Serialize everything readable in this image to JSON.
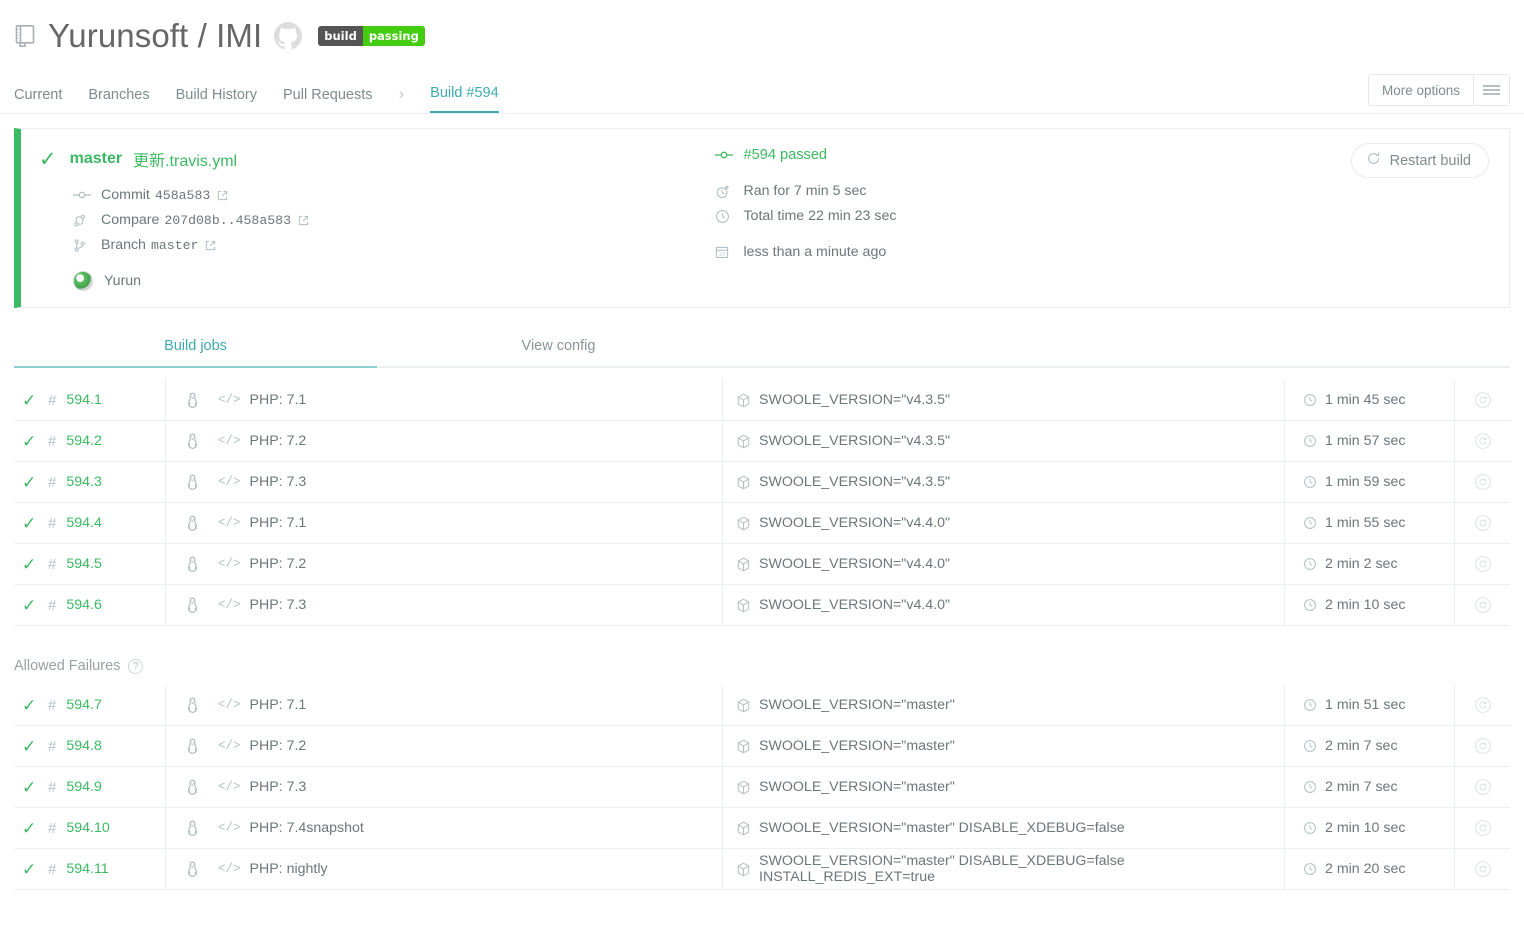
{
  "header": {
    "repo_icon": "repository-icon",
    "title": "Yurunsoft / IMI",
    "github_icon": "github-octocat-icon",
    "badge": {
      "left": "build",
      "right": "passing",
      "left_color": "#555555",
      "right_color": "#44cc11"
    }
  },
  "nav": {
    "tabs": [
      {
        "label": "Current",
        "active": false
      },
      {
        "label": "Branches",
        "active": false
      },
      {
        "label": "Build History",
        "active": false
      },
      {
        "label": "Pull Requests",
        "active": false
      }
    ],
    "separator": "›",
    "breadcrumb_current": "Build #594",
    "more_options_label": "More options"
  },
  "summary": {
    "state_icon": "check-icon",
    "branch": "master",
    "commit_message": "更新.travis.yml",
    "meta": [
      {
        "icon": "commit-icon",
        "label": "Commit",
        "value": "458a583",
        "mono": true,
        "external": true
      },
      {
        "icon": "compare-icon",
        "label": "Compare",
        "value": "207d08b..458a583",
        "mono": true,
        "external": true
      },
      {
        "icon": "branch-icon",
        "label": "Branch",
        "value": "master",
        "mono": true,
        "external": true
      }
    ],
    "author": "Yurun",
    "status": "#594 passed",
    "status_icon": "commit-icon",
    "timings": [
      {
        "icon": "stopwatch-icon",
        "text": "Ran for 7 min 5 sec"
      },
      {
        "icon": "clock-icon",
        "text": "Total time 22 min 23 sec"
      }
    ],
    "finished": {
      "icon": "calendar-icon",
      "text": "less than a minute ago"
    },
    "restart_label": "Restart build",
    "accent_color": "#3cb963"
  },
  "jobs_tabs": [
    {
      "label": "Build jobs",
      "active": true
    },
    {
      "label": "View config",
      "active": false
    }
  ],
  "jobs": [
    {
      "state": "✓",
      "number": "594.1",
      "os": "linux-penguin-icon",
      "lang": "PHP: 7.1",
      "env": "SWOOLE_VERSION=\"v4.3.5\"",
      "duration": "1 min 45 sec"
    },
    {
      "state": "✓",
      "number": "594.2",
      "os": "linux-penguin-icon",
      "lang": "PHP: 7.2",
      "env": "SWOOLE_VERSION=\"v4.3.5\"",
      "duration": "1 min 57 sec"
    },
    {
      "state": "✓",
      "number": "594.3",
      "os": "linux-penguin-icon",
      "lang": "PHP: 7.3",
      "env": "SWOOLE_VERSION=\"v4.3.5\"",
      "duration": "1 min 59 sec"
    },
    {
      "state": "✓",
      "number": "594.4",
      "os": "linux-penguin-icon",
      "lang": "PHP: 7.1",
      "env": "SWOOLE_VERSION=\"v4.4.0\"",
      "duration": "1 min 55 sec"
    },
    {
      "state": "✓",
      "number": "594.5",
      "os": "linux-penguin-icon",
      "lang": "PHP: 7.2",
      "env": "SWOOLE_VERSION=\"v4.4.0\"",
      "duration": "2 min 2 sec"
    },
    {
      "state": "✓",
      "number": "594.6",
      "os": "linux-penguin-icon",
      "lang": "PHP: 7.3",
      "env": "SWOOLE_VERSION=\"v4.4.0\"",
      "duration": "2 min 10 sec"
    }
  ],
  "allowed_failures": {
    "label": "Allowed Failures",
    "help_icon": "?",
    "jobs": [
      {
        "state": "✓",
        "number": "594.7",
        "os": "linux-penguin-icon",
        "lang": "PHP: 7.1",
        "env": "SWOOLE_VERSION=\"master\"",
        "duration": "1 min 51 sec"
      },
      {
        "state": "✓",
        "number": "594.8",
        "os": "linux-penguin-icon",
        "lang": "PHP: 7.2",
        "env": "SWOOLE_VERSION=\"master\"",
        "duration": "2 min 7 sec"
      },
      {
        "state": "✓",
        "number": "594.9",
        "os": "linux-penguin-icon",
        "lang": "PHP: 7.3",
        "env": "SWOOLE_VERSION=\"master\"",
        "duration": "2 min 7 sec"
      },
      {
        "state": "✓",
        "number": "594.10",
        "os": "linux-penguin-icon",
        "lang": "PHP: 7.4snapshot",
        "env": "SWOOLE_VERSION=\"master\" DISABLE_XDEBUG=false",
        "duration": "2 min 10 sec"
      },
      {
        "state": "✓",
        "number": "594.11",
        "os": "linux-penguin-icon",
        "lang": "PHP: nightly",
        "env": "SWOOLE_VERSION=\"master\" DISABLE_XDEBUG=false INSTALL_REDIS_EXT=true",
        "duration": "2 min 20 sec"
      }
    ]
  }
}
